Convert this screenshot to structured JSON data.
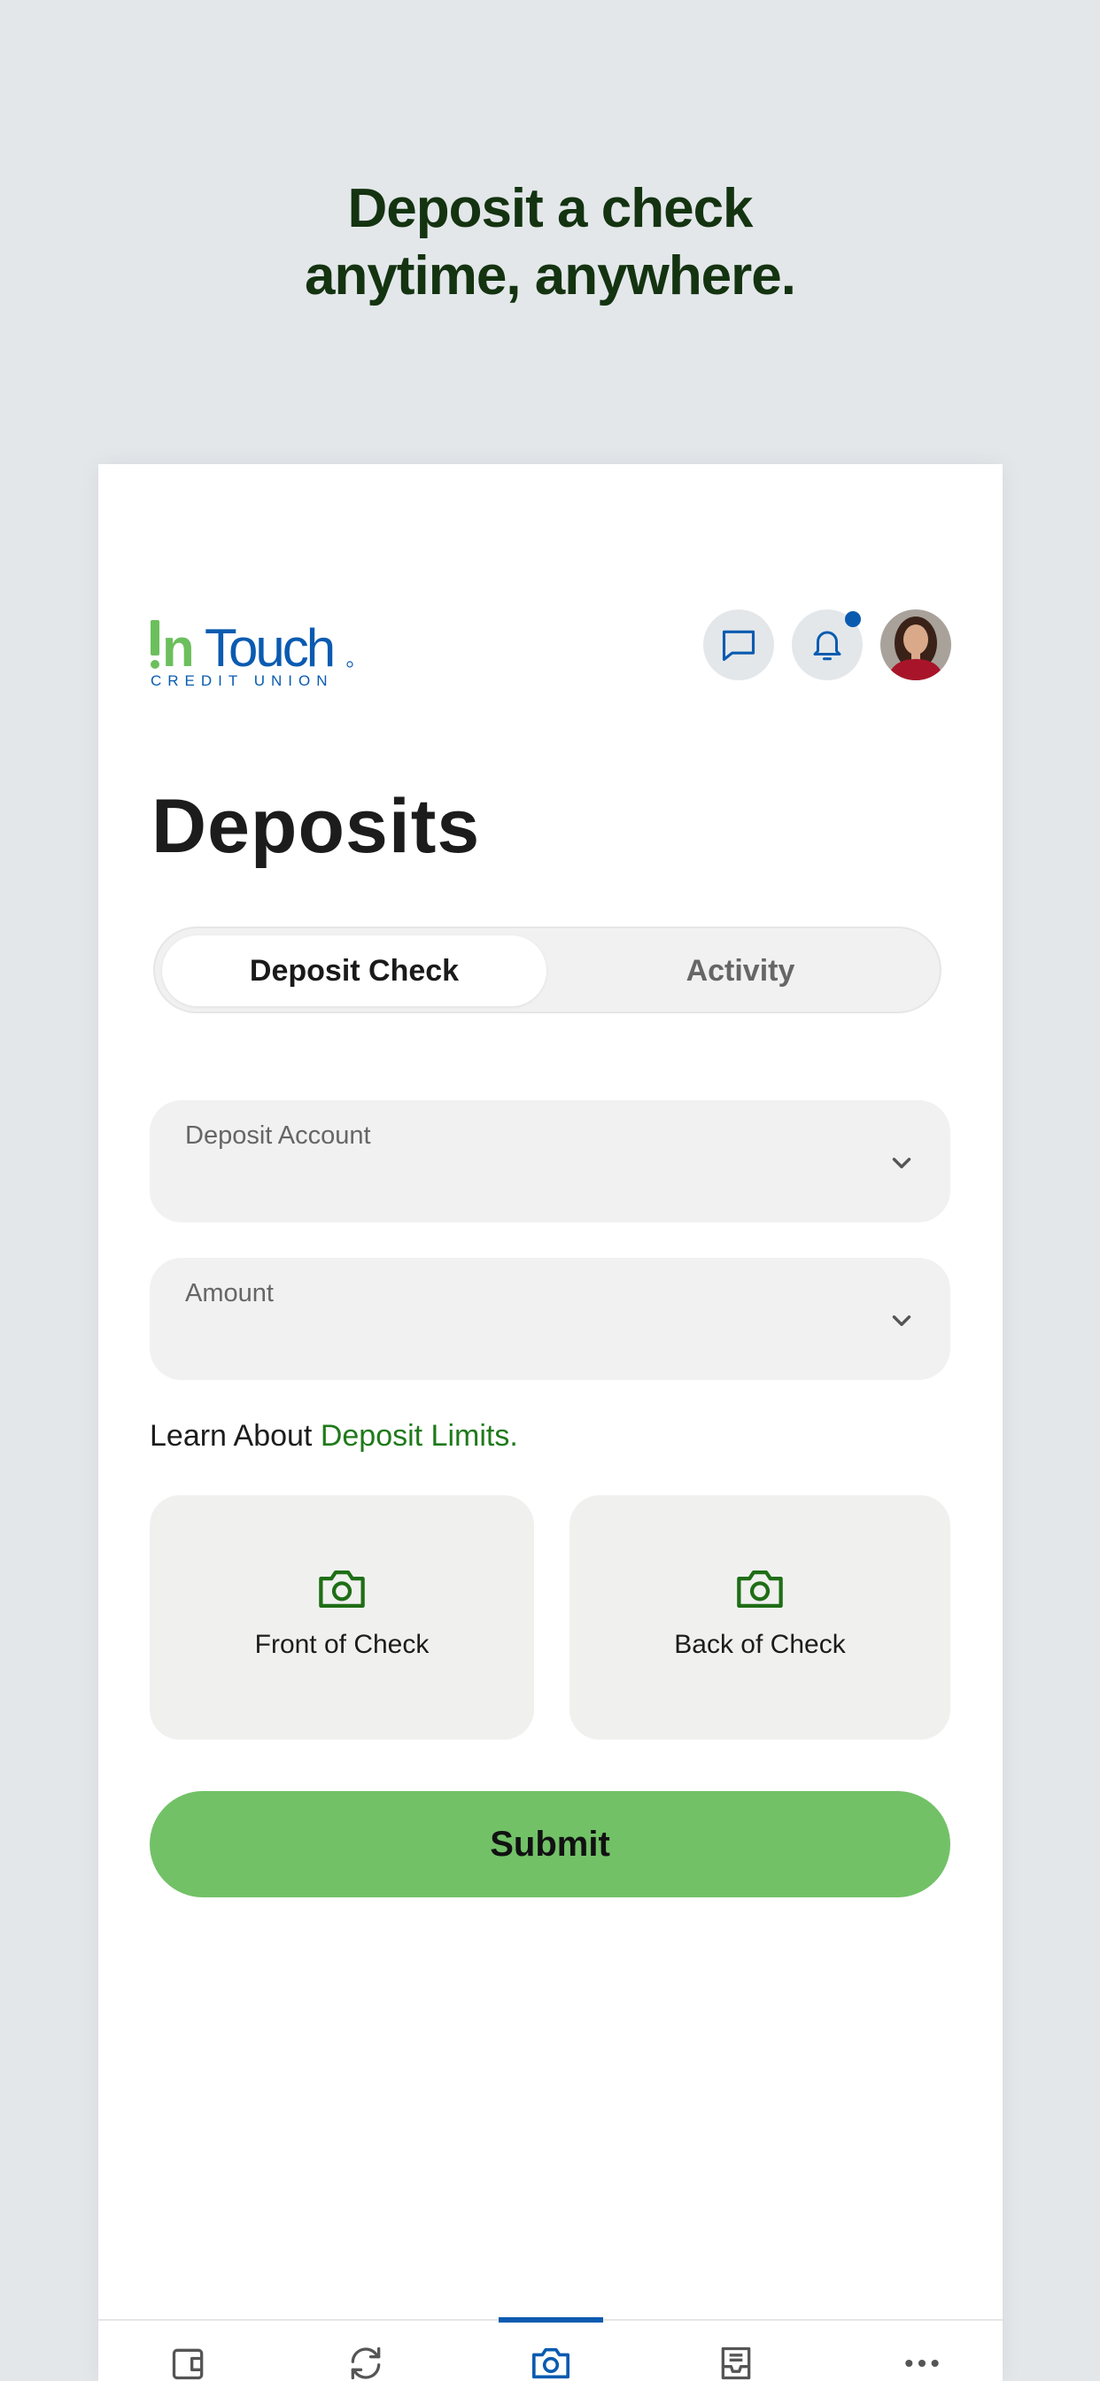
{
  "promo": {
    "headline_line1": "Deposit a check",
    "headline_line2": "anytime, anywhere."
  },
  "brand": {
    "logo_main": "InTouch",
    "logo_sub": "CREDIT UNION",
    "green": "#6cbf5d",
    "blue": "#0a5bb0"
  },
  "header": {
    "icons": [
      "chat-icon",
      "bell-icon",
      "avatar"
    ]
  },
  "page": {
    "title": "Deposits"
  },
  "tabs": [
    {
      "label": "Deposit Check",
      "active": true
    },
    {
      "label": "Activity",
      "active": false
    }
  ],
  "form": {
    "deposit_account_label": "Deposit Account",
    "amount_label": "Amount",
    "learn_prefix": "Learn About ",
    "learn_link": "Deposit Limits.",
    "front_label": "Front of Check",
    "back_label": "Back of Check",
    "submit_label": "Submit"
  },
  "bottom_nav": {
    "items": [
      "wallet-icon",
      "transfer-icon",
      "camera-icon",
      "inbox-icon",
      "more-icon"
    ],
    "active_index": 2
  }
}
